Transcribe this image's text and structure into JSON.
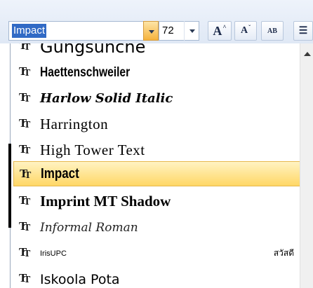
{
  "toolbar": {
    "font_name_value": "Impact",
    "font_size_value": "72",
    "grow_font_label": "A",
    "shrink_font_label": "A",
    "clear_format_label": "AB"
  },
  "font_list": [
    {
      "label": "Gungsuhche",
      "selected": false
    },
    {
      "label": "Haettenschweiler",
      "selected": false
    },
    {
      "label": "Harlow Solid Italic",
      "selected": false
    },
    {
      "label": "Harrington",
      "selected": false
    },
    {
      "label": "High Tower Text",
      "selected": false
    },
    {
      "label": "Impact",
      "selected": true
    },
    {
      "label": "Imprint MT Shadow",
      "selected": false
    },
    {
      "label": "Informal Roman",
      "selected": false
    },
    {
      "label": "IrisUPC",
      "selected": false,
      "sample": "สวัสดี"
    },
    {
      "label": "Iskoola Pota",
      "selected": false
    }
  ],
  "colors": {
    "selection_top": "#fff3c2",
    "selection_bottom": "#ffd766",
    "highlight_blue": "#316ac5"
  }
}
